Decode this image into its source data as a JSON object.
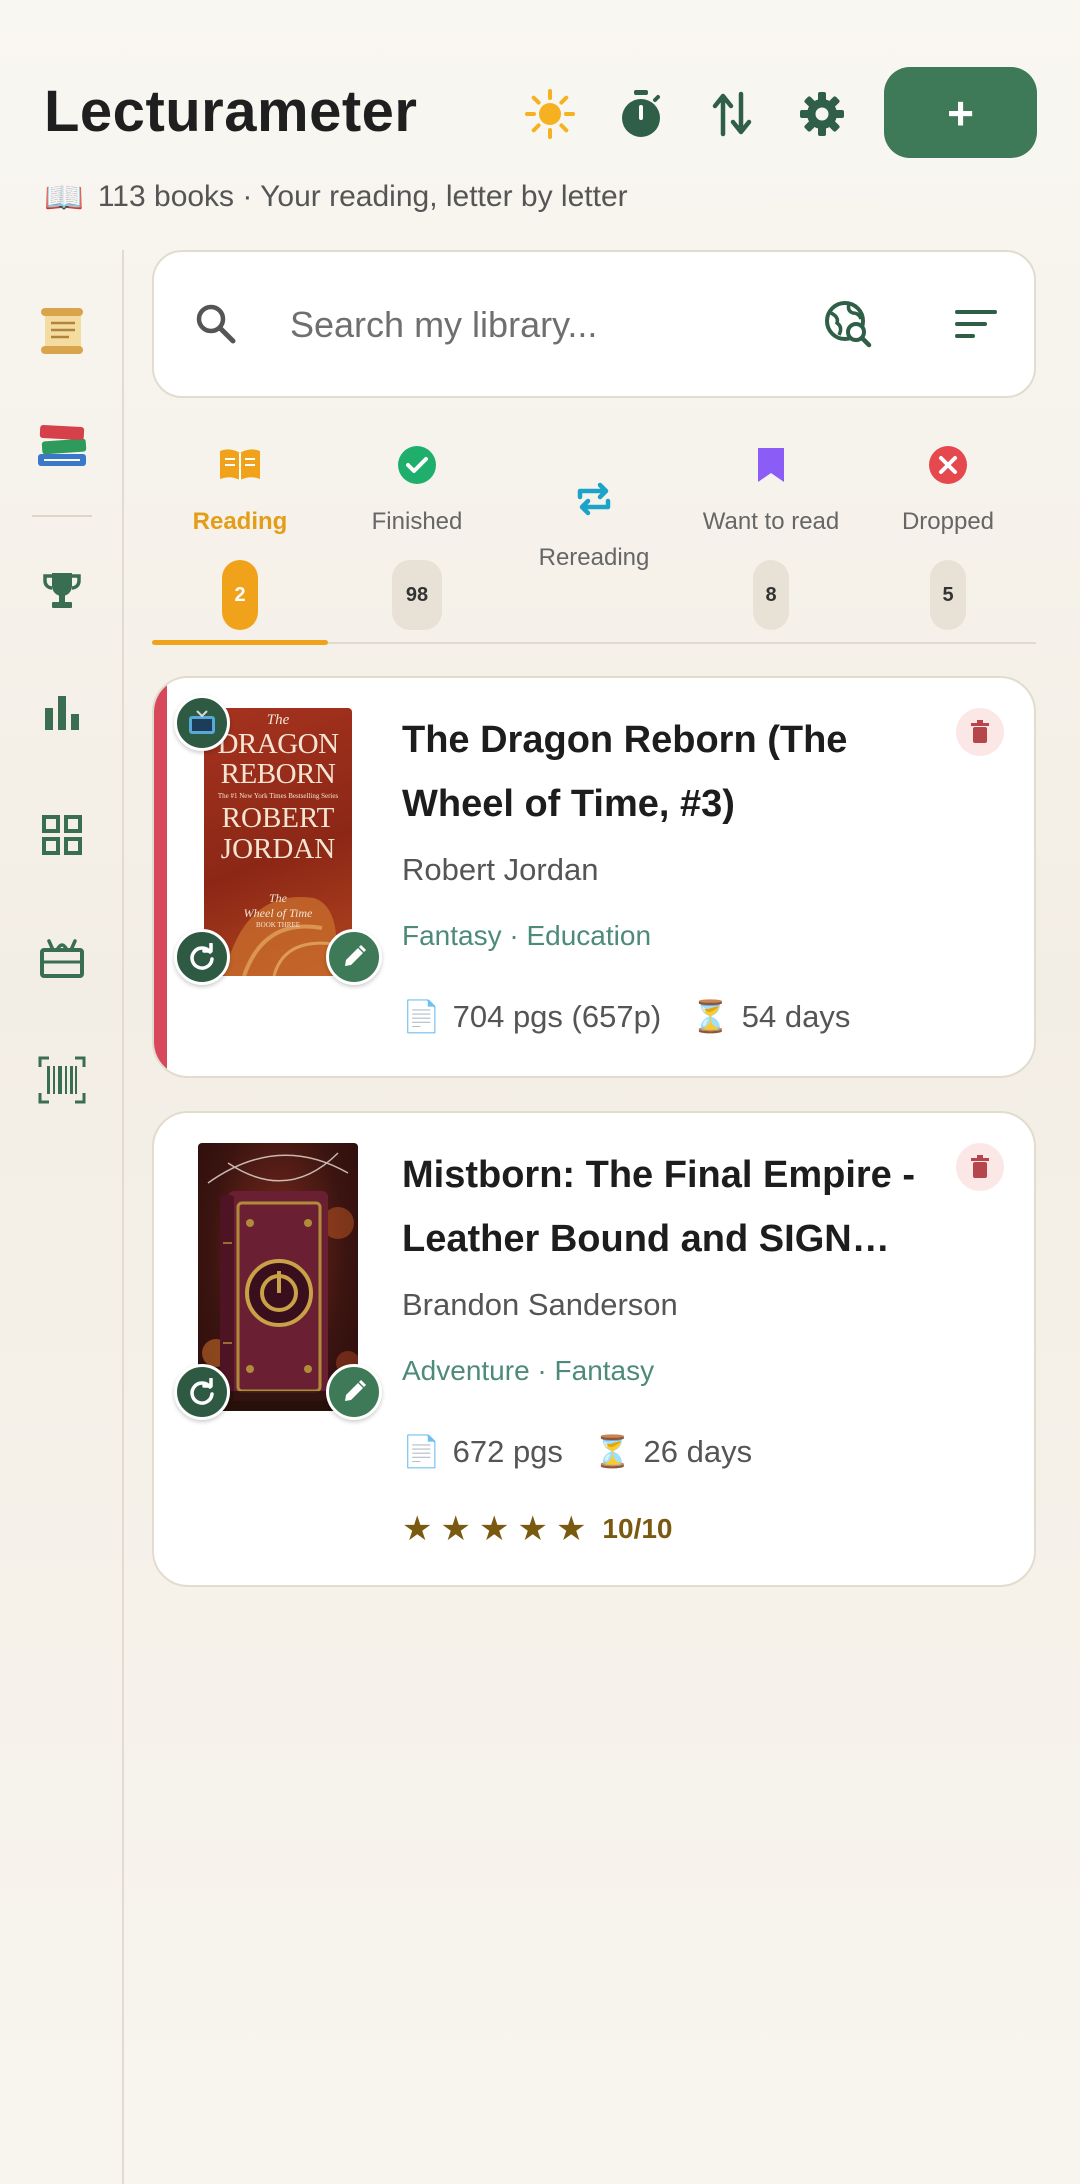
{
  "header": {
    "title": "Lecturameter",
    "subtitle": "113 books · Your reading, letter by letter",
    "subtitle_icon": "open-book-emoji",
    "add_label": "+",
    "icons": [
      "sun-icon",
      "timer-icon",
      "swap-vertical-icon",
      "gear-icon"
    ]
  },
  "sidebar": {
    "items": [
      "scroll-icon",
      "books-stack-icon",
      "trophy-icon",
      "bar-chart-icon",
      "grid-icon",
      "ticket-icon",
      "barcode-icon"
    ]
  },
  "search": {
    "placeholder": "Search my library...",
    "icons": [
      "search-icon",
      "web-search-icon",
      "sort-icon"
    ]
  },
  "tabs": [
    {
      "label": "Reading",
      "count": "2",
      "icon": "open-book-icon",
      "color": "#f0a21a",
      "active": true
    },
    {
      "label": "Finished",
      "count": "98",
      "icon": "check-circle-icon",
      "color": "#1fae6b"
    },
    {
      "label": "Rereading",
      "count": "",
      "icon": "repeat-icon",
      "color": "#1ba3c8"
    },
    {
      "label": "Want to read",
      "count": "8",
      "icon": "bookmark-icon",
      "color": "#8b5cf6"
    },
    {
      "label": "Dropped",
      "count": "5",
      "icon": "x-circle-icon",
      "color": "#e5484d"
    }
  ],
  "books": [
    {
      "title": "The Dragon Reborn (The Wheel of Time, #3)",
      "author": "Robert Jordan",
      "genres": "Fantasy · Education",
      "pages": "704 pgs (657p)",
      "days": "54 days",
      "accent_color": "#d6485a",
      "cover_text": {
        "top": "The",
        "line1": "DRAGON",
        "line2": "REBORN",
        "tagline": "The #1 New York Times Bestselling Series",
        "author1": "ROBERT",
        "author2": "JORDAN",
        "series1": "The",
        "series2": "Wheel of Time",
        "book_no": "BOOK THREE"
      }
    },
    {
      "title": "Mistborn: The Final Empire - Leather Bound and SIGN…",
      "author": "Brandon Sanderson",
      "genres": "Adventure · Fantasy",
      "pages": "672 pgs",
      "days": "26 days",
      "rating_stars": 5,
      "rating": "10/10"
    }
  ]
}
